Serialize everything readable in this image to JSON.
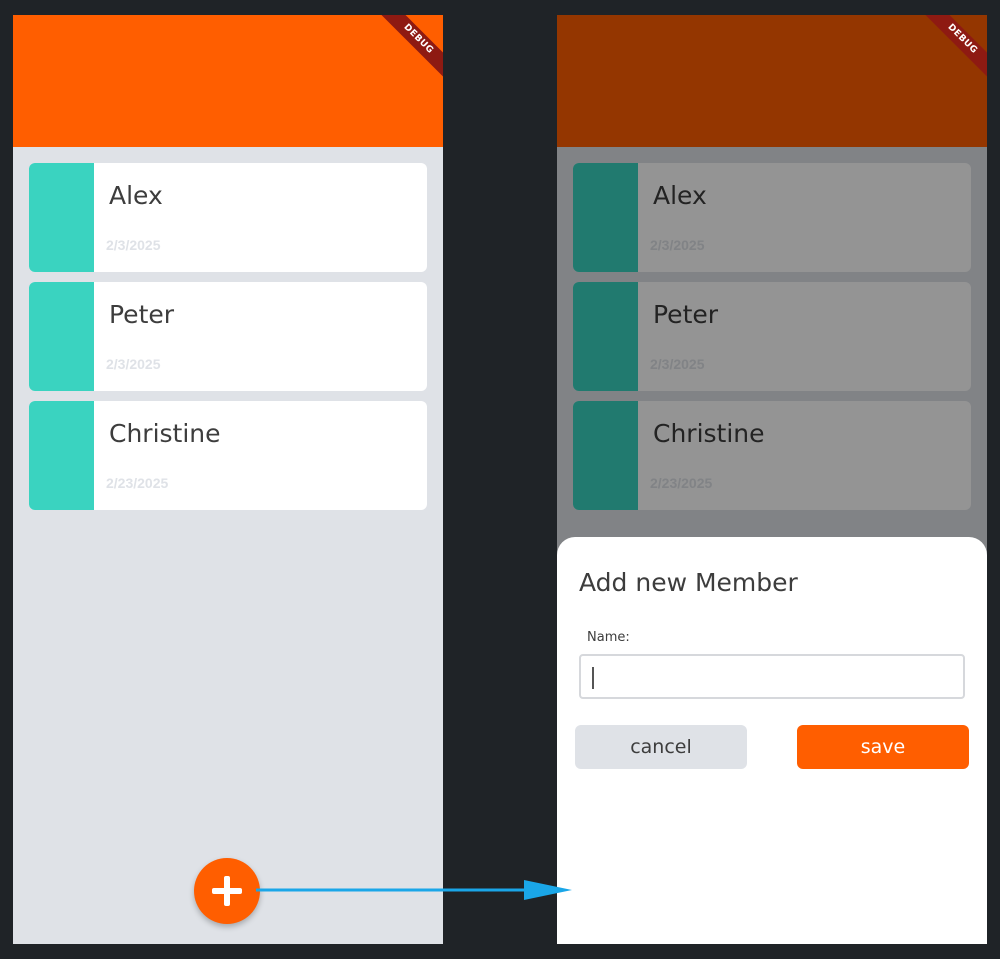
{
  "debug_label": "DEBUG",
  "colors": {
    "accent": "#ff5e00",
    "stripe": "#3ad3c0",
    "background": "#dfe2e7",
    "arrow": "#1aa6e8"
  },
  "members": [
    {
      "name": "Alex",
      "date": "2/3/2025"
    },
    {
      "name": "Peter",
      "date": "2/3/2025"
    },
    {
      "name": "Christine",
      "date": "2/23/2025"
    }
  ],
  "fab": {
    "icon": "plus-icon"
  },
  "dialog": {
    "title": "Add new Member",
    "field_label": "Name:",
    "field_value": "",
    "cancel_label": "cancel",
    "save_label": "save"
  }
}
